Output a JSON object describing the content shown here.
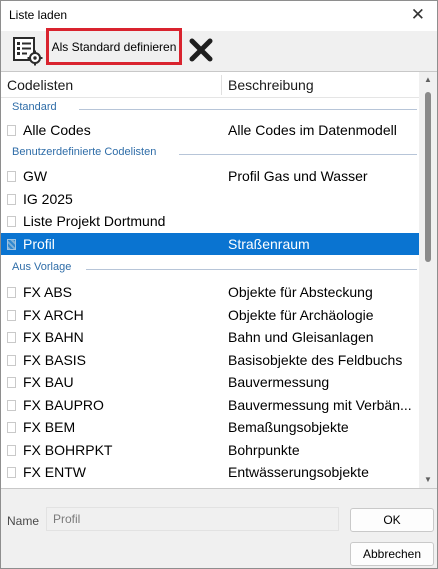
{
  "window": {
    "title": "Liste laden",
    "close_glyph": "✕"
  },
  "toolbar": {
    "list_icon": "list-settings-icon",
    "default_label": "Als Standard definieren",
    "delete_icon": "delete-x-icon"
  },
  "list": {
    "columns": [
      "Codelisten",
      "Beschreibung"
    ],
    "groups": [
      {
        "label": "Standard"
      },
      {
        "label": "Benutzerdefinierte Codelisten"
      },
      {
        "label": "Aus Vorlage"
      }
    ],
    "rows": [
      {
        "name": "Alle Codes",
        "description": "Alle Codes im Datenmodell"
      },
      {
        "name": "GW",
        "description": "Profil Gas und Wasser"
      },
      {
        "name": "IG 2025",
        "description": ""
      },
      {
        "name": "Liste Projekt Dortmund",
        "description": ""
      },
      {
        "name": "Profil",
        "description": "Straßenraum",
        "selected": true
      },
      {
        "name": "FX ABS",
        "description": "Objekte für Absteckung"
      },
      {
        "name": "FX ARCH",
        "description": "Objekte für Archäologie"
      },
      {
        "name": "FX BAHN",
        "description": "Bahn und Gleisanlagen"
      },
      {
        "name": "FX BASIS",
        "description": "Basisobjekte des Feldbuchs"
      },
      {
        "name": "FX BAU",
        "description": "Bauvermessung"
      },
      {
        "name": "FX BAUPRO",
        "description": "Bauvermessung mit Verbän..."
      },
      {
        "name": "FX BEM",
        "description": "Bemaßungsobjekte"
      },
      {
        "name": "FX BOHRPKT",
        "description": "Bohrpunkte"
      },
      {
        "name": "FX ENTW",
        "description": "Entwässerungsobjekte"
      }
    ]
  },
  "footer": {
    "name_label": "Name",
    "name_value": "Profil",
    "ok_label": "OK",
    "cancel_label": "Abbrechen"
  },
  "colors": {
    "selection": "#0a74d1",
    "highlight_border": "#d9232e",
    "group_text": "#2f6da8"
  }
}
